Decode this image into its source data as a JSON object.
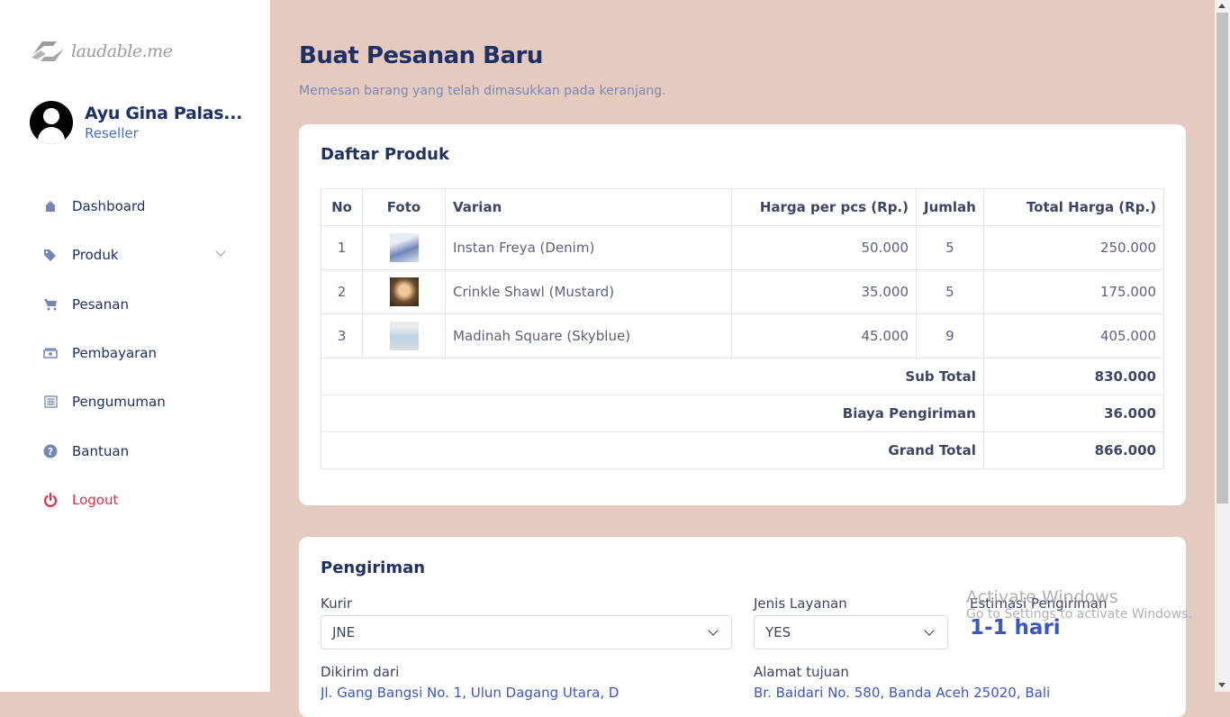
{
  "brand": {
    "logo_text": "laudable.me"
  },
  "user": {
    "name": "Ayu Gina Palas...",
    "role": "Reseller"
  },
  "sidebar": {
    "items": [
      {
        "label": "Dashboard",
        "icon": "home-icon"
      },
      {
        "label": "Produk",
        "icon": "tags-icon"
      },
      {
        "label": "Pesanan",
        "icon": "cart-icon"
      },
      {
        "label": "Pembayaran",
        "icon": "money-icon"
      },
      {
        "label": "Pengumuman",
        "icon": "newspaper-icon"
      },
      {
        "label": "Bantuan",
        "icon": "question-circle-icon"
      },
      {
        "label": "Logout",
        "icon": "power-icon"
      }
    ]
  },
  "page": {
    "title": "Buat Pesanan Baru",
    "subtitle": "Memesan barang yang telah dimasukkan pada keranjang."
  },
  "products": {
    "title": "Daftar Produk",
    "headers": [
      "No",
      "Foto",
      "Varian",
      "Harga per pcs (Rp.)",
      "Jumlah",
      "Total Harga (Rp.)"
    ],
    "rows": [
      {
        "no": "1",
        "variant": "Instan Freya (Denim)",
        "price": "50.000",
        "qty": "5",
        "total": "250.000"
      },
      {
        "no": "2",
        "variant": "Crinkle Shawl (Mustard)",
        "price": "35.000",
        "qty": "5",
        "total": "175.000"
      },
      {
        "no": "3",
        "variant": "Madinah Square (Skyblue)",
        "price": "45.000",
        "qty": "9",
        "total": "405.000"
      }
    ],
    "subtotal_label": "Sub Total",
    "subtotal": "830.000",
    "shipping_label": "Biaya Pengiriman",
    "shipping": "36.000",
    "grand_label": "Grand Total",
    "grand": "866.000"
  },
  "shipping": {
    "title": "Pengiriman",
    "courier_label": "Kurir",
    "courier": "JNE",
    "service_label": "Jenis Layanan",
    "service": "YES",
    "estimate_label": "Estimasi Pengiriman",
    "estimate": "1-1 hari",
    "from_label": "Dikirim dari",
    "from": "Jl. Gang Bangsi No. 1, Ulun Dagang Utara, D",
    "to_label": "Alamat tujuan",
    "to": "Br. Baidari No. 580, Banda Aceh 25020, Bali"
  },
  "watermark": {
    "line1": "Activate Windows",
    "line2": "Go to Settings to activate Windows."
  }
}
